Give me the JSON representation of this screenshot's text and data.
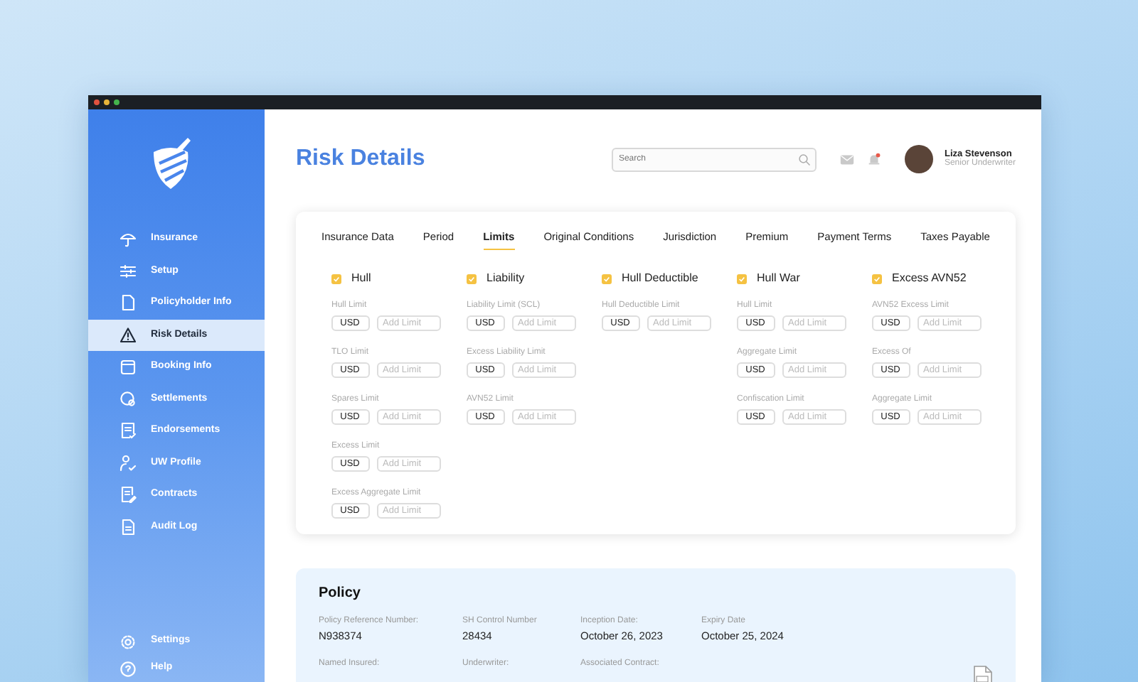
{
  "sidebar": {
    "items": [
      {
        "label": "Insurance",
        "selected": false
      },
      {
        "label": "Setup",
        "selected": false
      },
      {
        "label": "Policyholder Info",
        "selected": false
      },
      {
        "label": "Risk Details",
        "selected": true
      },
      {
        "label": "Booking Info",
        "selected": false
      },
      {
        "label": "Settlements",
        "selected": false
      },
      {
        "label": "Endorsements",
        "selected": false
      },
      {
        "label": "UW Profile",
        "selected": false
      },
      {
        "label": "Contracts",
        "selected": false
      },
      {
        "label": "Audit Log",
        "selected": false
      }
    ],
    "bottom_items": [
      {
        "label": "Settings",
        "selected": false
      },
      {
        "label": "Help",
        "selected": false
      }
    ]
  },
  "header": {
    "title": "Risk Details",
    "search": {
      "placeholder": "Search"
    },
    "notifications_unread": true,
    "user": {
      "name": "Liza Stevenson",
      "role": "Senior Underwriter"
    }
  },
  "tabs": [
    {
      "label": "Insurance Data",
      "selected": false
    },
    {
      "label": "Period",
      "selected": false
    },
    {
      "label": "Limits",
      "selected": true
    },
    {
      "label": "Original Conditions",
      "selected": false
    },
    {
      "label": "Jurisdiction",
      "selected": false
    },
    {
      "label": "Premium",
      "selected": false
    },
    {
      "label": "Payment Terms",
      "selected": false
    },
    {
      "label": "Taxes Payable",
      "selected": false
    }
  ],
  "limit_sections": [
    {
      "title": "Hull",
      "checked": true,
      "fields": [
        {
          "label": "Hull Limit",
          "currency": "USD",
          "placeholder": "Add Limit"
        },
        {
          "label": "TLO Limit",
          "currency": "USD",
          "placeholder": "Add Limit"
        },
        {
          "label": "Spares Limit",
          "currency": "USD",
          "placeholder": "Add Limit"
        },
        {
          "label": "Excess Limit",
          "currency": "USD",
          "placeholder": "Add Limit"
        },
        {
          "label": "Excess Aggregate Limit",
          "currency": "USD",
          "placeholder": "Add Limit"
        }
      ]
    },
    {
      "title": "Liability",
      "checked": true,
      "fields": [
        {
          "label": "Liability Limit (SCL)",
          "currency": "USD",
          "placeholder": "Add Limit"
        },
        {
          "label": "Excess Liability Limit",
          "currency": "USD",
          "placeholder": "Add Limit"
        },
        {
          "label": "AVN52 Limit",
          "currency": "USD",
          "placeholder": "Add Limit"
        }
      ]
    },
    {
      "title": "Hull Deductible",
      "checked": true,
      "fields": [
        {
          "label": "Hull Deductible Limit",
          "currency": "USD",
          "placeholder": "Add Limit"
        }
      ]
    },
    {
      "title": "Hull War",
      "checked": true,
      "fields": [
        {
          "label": "Hull Limit",
          "currency": "USD",
          "placeholder": "Add Limit"
        },
        {
          "label": "Aggregate Limit",
          "currency": "USD",
          "placeholder": "Add Limit"
        },
        {
          "label": "Confiscation Limit",
          "currency": "USD",
          "placeholder": "Add Limit"
        }
      ]
    },
    {
      "title": "Excess AVN52",
      "checked": true,
      "fields": [
        {
          "label": "AVN52 Excess Limit",
          "currency": "USD",
          "placeholder": "Add Limit"
        },
        {
          "label": "Excess Of",
          "currency": "USD",
          "placeholder": "Add Limit"
        },
        {
          "label": "Aggregate Limit",
          "currency": "USD",
          "placeholder": "Add Limit"
        }
      ]
    }
  ],
  "policy": {
    "title": "Policy",
    "rows": [
      [
        {
          "label": "Policy Reference Number:",
          "value": "N938374"
        },
        {
          "label": "SH Control Number",
          "value": "28434"
        },
        {
          "label": "Inception Date:",
          "value": "October 26, 2023"
        },
        {
          "label": "Expiry Date",
          "value": "October 25, 2024"
        }
      ],
      [
        {
          "label": "Named Insured:"
        },
        {
          "label": "Underwriter:"
        },
        {
          "label": "Associated Contract:"
        }
      ]
    ]
  }
}
